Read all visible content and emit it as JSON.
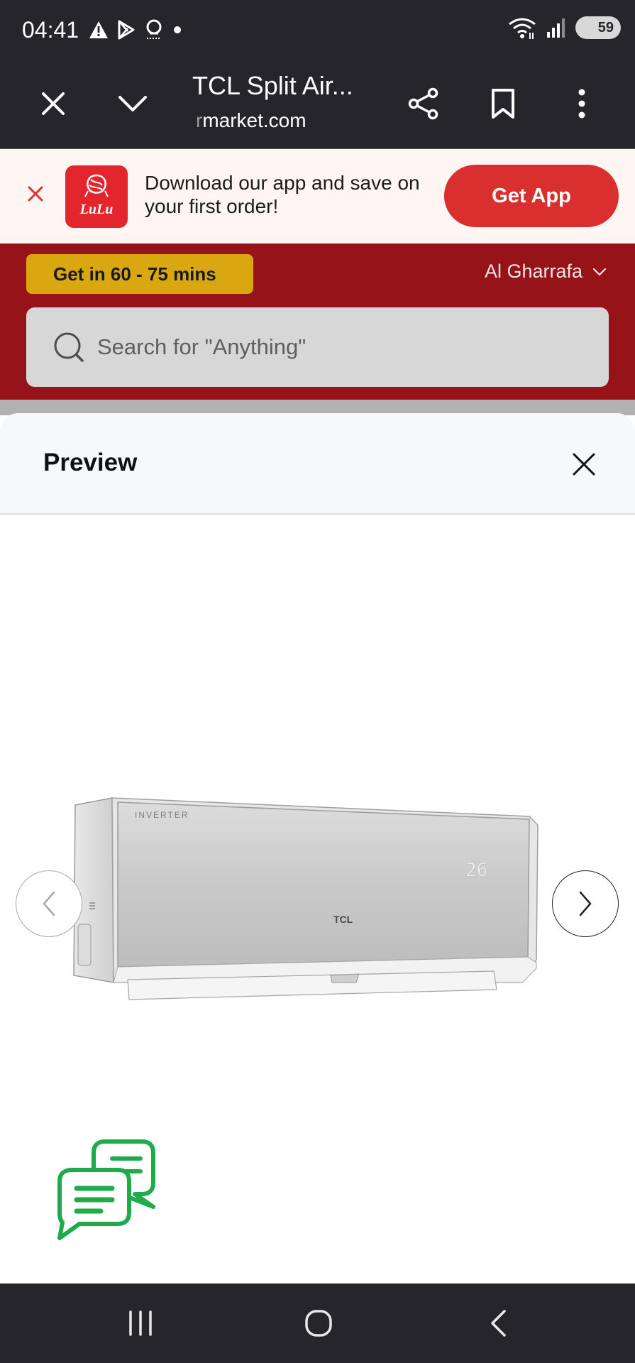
{
  "status_bar": {
    "time": "04:41",
    "battery": "59",
    "icons_left": [
      "warning-icon",
      "play-store-icon",
      "notification-icon",
      "dot-icon"
    ],
    "icons_right": [
      "wifi-icon",
      "signal-icon",
      "battery-icon"
    ]
  },
  "browser": {
    "tab_title": "TCL Split Air...",
    "url_prefix": "r",
    "url": "market.com",
    "icons": [
      "close-icon",
      "chevron-down-icon",
      "share-icon",
      "bookmark-icon",
      "more-vert-icon"
    ]
  },
  "app_banner": {
    "message": "Download our app and save on your first order!",
    "logo_text": "LuLu",
    "cta_label": "Get App"
  },
  "header": {
    "delivery_label": "Get in 60 - 75 mins",
    "location": "Al Gharrafa",
    "search_placeholder": "Search for \"Anything\""
  },
  "preview_sheet": {
    "title": "Preview",
    "product_brand": "TCL",
    "product_badge": "INVERTER",
    "display_temp": "26"
  },
  "colors": {
    "accent_red": "#961419",
    "cta_red": "#da2f2f",
    "delivery_yellow": "#d9a70f",
    "chat_green": "#1faa4b",
    "system_bar": "#26262a"
  }
}
